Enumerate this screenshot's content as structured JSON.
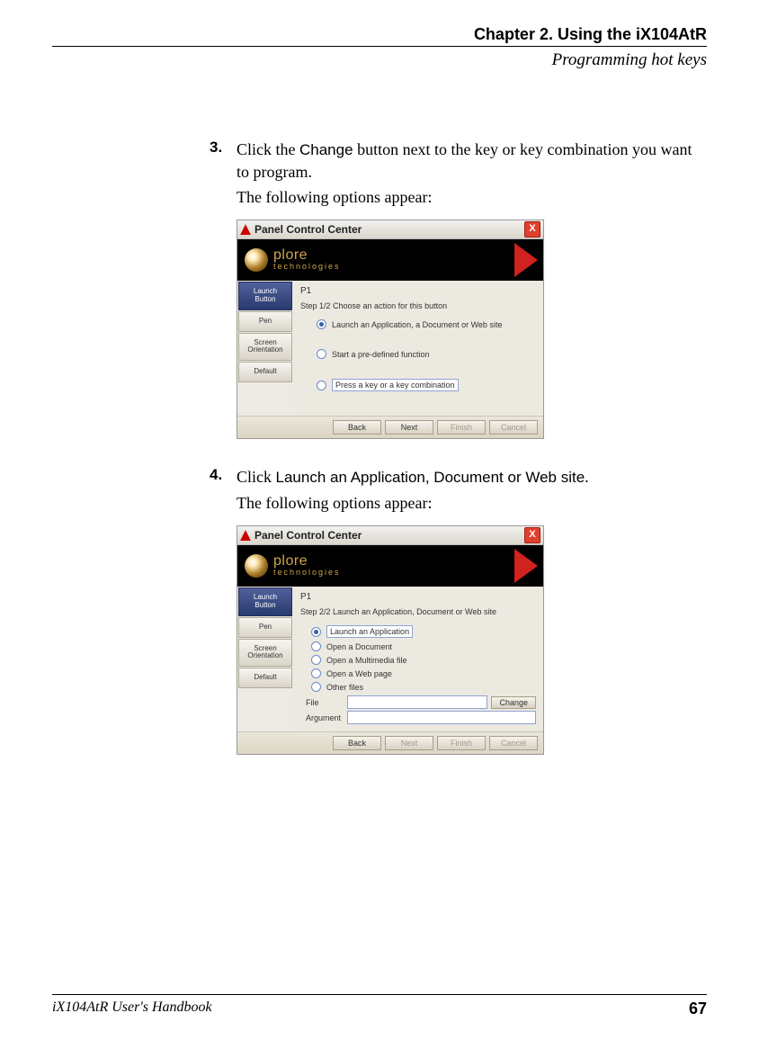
{
  "header": {
    "chapter": "Chapter 2. Using the iX104AtR",
    "section": "Programming hot keys"
  },
  "steps": {
    "s3": {
      "num": "3.",
      "pre": "Click the ",
      "sans": "Change",
      "post": " button next to the key or key combination you want to program.",
      "caption": "The following options appear:"
    },
    "s4": {
      "num": "4.",
      "pre": "Click ",
      "sans": "Launch an Application, Document or Web site",
      "post": ".",
      "caption": "The following options appear:"
    }
  },
  "dialog": {
    "title": "Panel Control Center",
    "brand_line1": "plore",
    "brand_line2": "technologies",
    "tabs": {
      "t1": "Launch\nButton",
      "t2": "Pen",
      "t3": "Screen\nOrientation",
      "t4": "Default"
    },
    "p1": {
      "name": "P1",
      "step": "Step 1/2     Choose an action for this button",
      "opt1": "Launch an Application, a Document or Web site",
      "opt2": "Start a pre-defined function",
      "opt3": "Press a key or a key combination"
    },
    "p2": {
      "name": "P1",
      "step": "Step 2/2     Launch an Application, Document or Web site",
      "opt1": "Launch an Application",
      "opt2": "Open a Document",
      "opt3": "Open a Multimedia file",
      "opt4": "Open a Web page",
      "opt5": "Other files",
      "file_lbl": "File",
      "arg_lbl": "Argument",
      "change_btn": "Change"
    },
    "buttons": {
      "back": "Back",
      "next": "Next",
      "finish": "Finish",
      "cancel": "Cancel"
    }
  },
  "footer": {
    "left": "iX104AtR User's Handbook",
    "right": "67"
  }
}
